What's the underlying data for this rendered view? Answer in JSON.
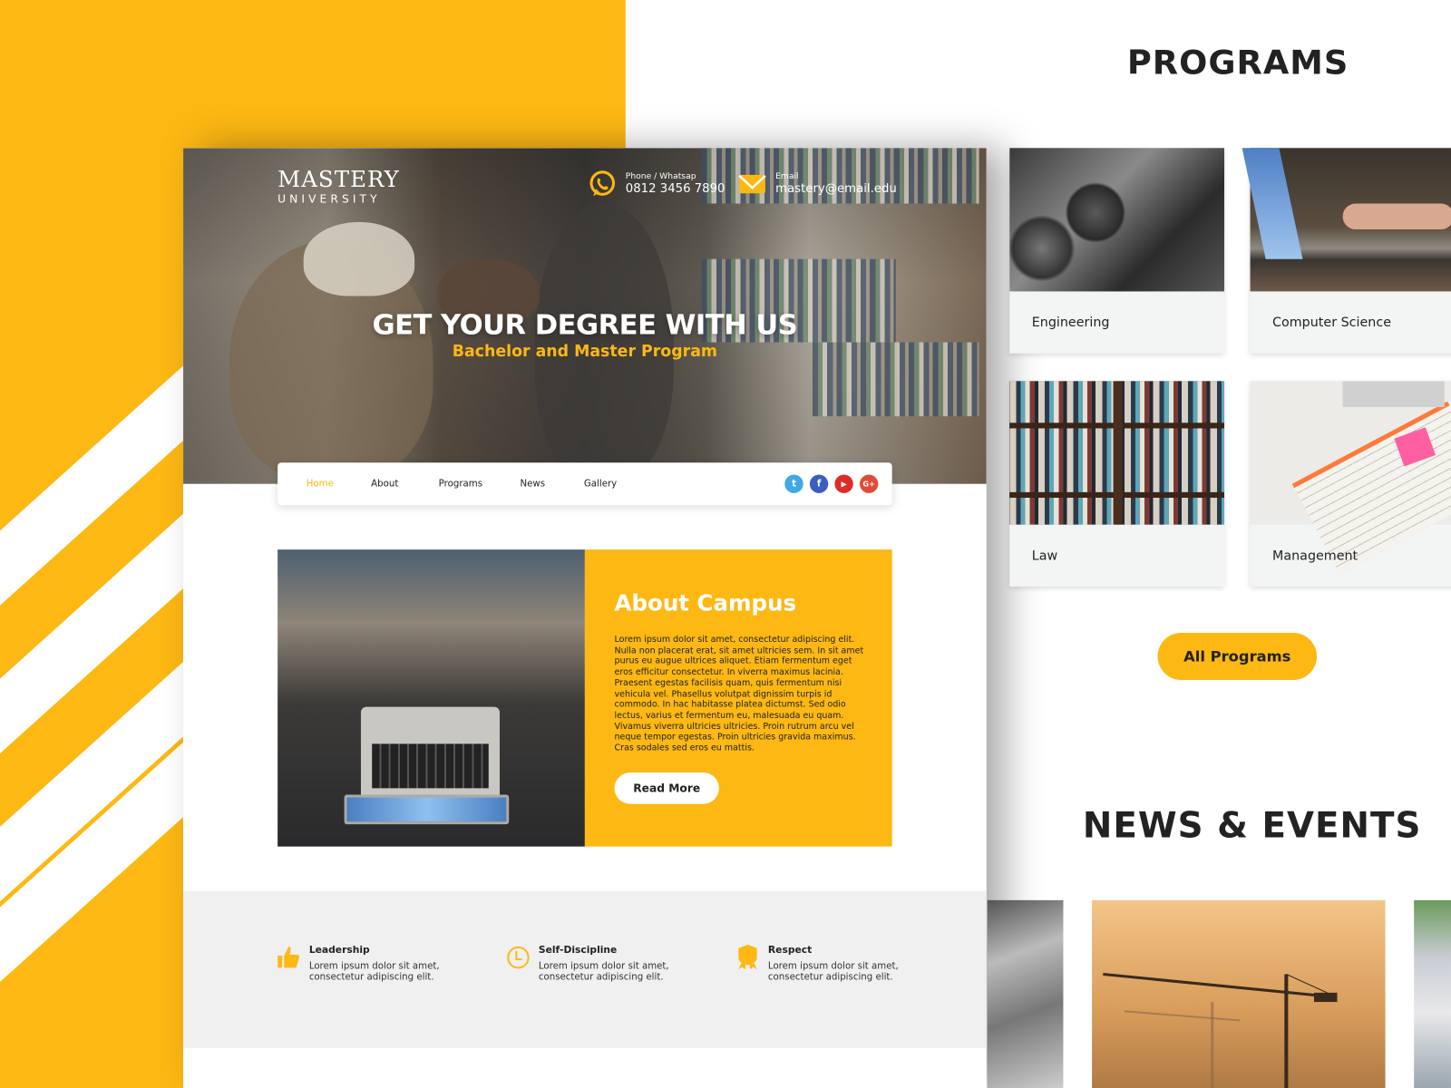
{
  "brand": {
    "line1": "MASTERY",
    "line2": "UNIVERSITY"
  },
  "contact": {
    "phone": {
      "label": "Phone / Whatsap",
      "value": "0812 3456 7890",
      "icon": "whatsapp-icon"
    },
    "email": {
      "label": "Email",
      "value": "mastery@email.edu",
      "icon": "envelope-icon"
    }
  },
  "hero": {
    "title": "GET YOUR DEGREE WITH US",
    "subtitle": "Bachelor and Master Program"
  },
  "nav": {
    "items": [
      "Home",
      "About",
      "Programs",
      "News",
      "Gallery"
    ],
    "active": "Home",
    "social": [
      {
        "name": "twitter",
        "glyph": "t",
        "color": "#3fa9e6"
      },
      {
        "name": "facebook",
        "glyph": "f",
        "color": "#3b5fc0"
      },
      {
        "name": "youtube",
        "glyph": "▶",
        "color": "#e02b27"
      },
      {
        "name": "google-plus",
        "glyph": "G+",
        "color": "#e04b37"
      }
    ]
  },
  "about": {
    "title": "About Campus",
    "text": "Lorem ipsum dolor sit amet, consectetur adipiscing elit. Nulla non placerat erat, sit amet ultricies sem. In sit amet purus eu augue ultrices aliquet. Etiam fermentum eget eros efficitur consectetur. In viverra maximus lacinia. Praesent egestas facilisis quam, quis fermentum nisi vehicula vel. Phasellus volutpat dignissim turpis id commodo. In hac habitasse platea dictumst. Sed odio lectus, varius et fermentum eu, malesuada eu quam. Vivamus viverra ultricies ultricies. Proin rutrum arcu vel neque tempor egestas. Proin ultricies gravida maximus. Cras sodales sed eros eu mattis.",
    "button": "Read More"
  },
  "features": [
    {
      "title": "Leadership",
      "text": "Lorem ipsum dolor sit amet, consectetur adipiscing elit.",
      "icon": "thumbs-up-icon"
    },
    {
      "title": "Self-Discipline",
      "text": "Lorem ipsum dolor sit amet, consectetur adipiscing elit.",
      "icon": "clock-icon"
    },
    {
      "title": "Respect",
      "text": "Lorem ipsum dolor sit amet, consectetur adipiscing elit.",
      "icon": "badge-icon"
    }
  ],
  "programs": {
    "title": "PROGRAMS",
    "items": [
      "Engineering",
      "Computer Science",
      "Law",
      "Management"
    ],
    "button": "All Programs"
  },
  "news": {
    "title": "NEWS & EVENTS"
  },
  "colors": {
    "accent": "#fdb813",
    "text": "#222222",
    "panel": "#f0f0f0"
  }
}
